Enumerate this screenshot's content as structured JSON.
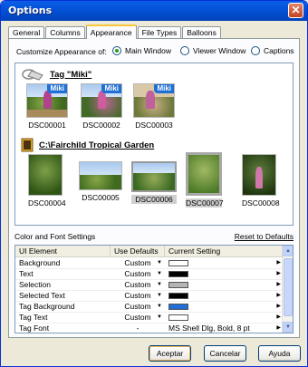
{
  "window": {
    "title": "Options",
    "close_glyph": "✕"
  },
  "tabs": [
    "General",
    "Columns",
    "Appearance",
    "File Types",
    "Balloons"
  ],
  "customize": {
    "label": "Customize Appearance of:",
    "options": [
      {
        "label": "Main Window",
        "checked": true
      },
      {
        "label": "Viewer Window",
        "checked": false
      },
      {
        "label": "Captions",
        "checked": false
      }
    ]
  },
  "group1": {
    "title": "Tag \"Miki\"",
    "icon": "tag-icon",
    "items": [
      {
        "caption": "DSC00001",
        "badge": "Miki"
      },
      {
        "caption": "DSC00002",
        "badge": "Miki"
      },
      {
        "caption": "DSC00003",
        "badge": "Miki"
      }
    ]
  },
  "group2": {
    "title": "C:\\Fairchild Tropical Garden",
    "icon": "film-folder-icon",
    "items": [
      {
        "caption": "DSC00004"
      },
      {
        "caption": "DSC00005"
      },
      {
        "caption": "DSC00006"
      },
      {
        "caption": "DSC00007"
      },
      {
        "caption": "DSC00008"
      }
    ]
  },
  "color_font": {
    "label": "Color and Font Settings",
    "reset_link": "Reset to Defaults",
    "headers": {
      "element": "UI Element",
      "defaults": "Use Defaults",
      "setting": "Current Setting"
    },
    "rows": [
      {
        "element": "Background",
        "defaults": "Custom",
        "setting": "",
        "swatch": "#ffffff"
      },
      {
        "element": "Text",
        "defaults": "Custom",
        "setting": "",
        "swatch": "#000000"
      },
      {
        "element": "Selection",
        "defaults": "Custom",
        "setting": "",
        "swatch": "#b4b4b4"
      },
      {
        "element": "Selected Text",
        "defaults": "Custom",
        "setting": "",
        "swatch": "#000000"
      },
      {
        "element": "Tag Background",
        "defaults": "Custom",
        "setting": "",
        "swatch": "#1f6fd6"
      },
      {
        "element": "Tag Text",
        "defaults": "Custom",
        "setting": "",
        "swatch": "#ffffff"
      },
      {
        "element": "Tag Font",
        "defaults": "-",
        "setting": "MS Shell Dlg, Bold, 8 pt",
        "swatch": ""
      }
    ]
  },
  "buttons": {
    "ok": "Aceptar",
    "cancel": "Cancelar",
    "help": "Ayuda"
  }
}
